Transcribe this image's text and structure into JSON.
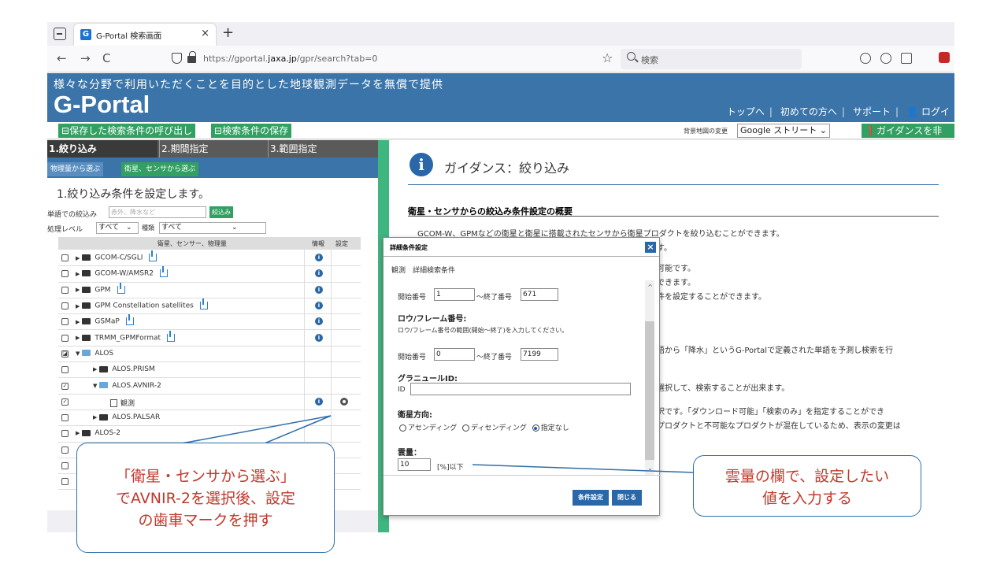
{
  "browser": {
    "tab_title": "G-Portal 検索画面",
    "tab_close": "×",
    "new_tab": "+",
    "back": "←",
    "forward": "→",
    "reload": "C",
    "url_host_prefix": "https://gportal.",
    "url_host_bold": "jaxa.jp",
    "url_path": "/gpr/search?tab=0",
    "search_placeholder": "検索"
  },
  "site": {
    "tagline": "様々な分野で利用いただくことを目的とした地球観測データを無償で提供",
    "logo": "G-Portal",
    "nav": [
      "トップへ",
      "初めての方へ",
      "サポート",
      "ログイ"
    ],
    "saved_conditions_btn": "保存した検索条件の呼び出し",
    "save_conditions_btn": "検索条件の保存",
    "bg_map_label": "背景地図の変更",
    "bg_map_value": "Google ストリート ⌄",
    "guidance_btn": "ガイダンスを非表"
  },
  "left": {
    "steps": [
      "1.絞り込み",
      "2.期間指定",
      "3.範囲指定"
    ],
    "modes": [
      "物理量から選ぶ",
      "衛星、センサから選ぶ"
    ],
    "filter_title": "1.絞り込み条件を設定します。",
    "keyword_label": "単語での絞込み",
    "keyword_placeholder": "赤外、降水など",
    "keyword_btn": "絞込み",
    "level_label": "処理レベル",
    "level_value": "すべて　⌄",
    "mode_label": "種類",
    "mode_value": "すべて　　　　　　　⌄",
    "tree_headers": [
      "衛星、センサー、物理量",
      "情報",
      "設定"
    ],
    "tree": [
      {
        "label": "GCOM-C/SGLI",
        "indent": 0,
        "dl": true,
        "info": true
      },
      {
        "label": "GCOM-W/AMSR2",
        "indent": 0,
        "dl": true,
        "info": true
      },
      {
        "label": "GPM",
        "indent": 0,
        "dl": true,
        "info": true
      },
      {
        "label": "GPM Constellation satellites",
        "indent": 0,
        "dl": true,
        "info": true
      },
      {
        "label": "GSMaP",
        "indent": 0,
        "dl": true,
        "info": true
      },
      {
        "label": "TRMM_GPMFormat",
        "indent": 0,
        "dl": true,
        "info": true
      },
      {
        "label": "ALOS",
        "indent": 0,
        "open": true,
        "check": "◪"
      },
      {
        "label": "ALOS.PRISM",
        "indent": 1
      },
      {
        "label": "ALOS.AVNIR-2",
        "indent": 1,
        "open": true,
        "check": "✓"
      },
      {
        "label": "観測",
        "indent": 2,
        "obs": true,
        "info": true,
        "gear": true,
        "check": "✓"
      },
      {
        "label": "ALOS.PALSAR",
        "indent": 1
      },
      {
        "label": "ALOS-2",
        "indent": 0
      },
      {
        "label": "",
        "indent": 0
      },
      {
        "label": "",
        "indent": 0
      },
      {
        "label": "",
        "indent": 0
      }
    ]
  },
  "guidance": {
    "icon": "i",
    "title": "ガイダンス：絞り込み",
    "subtitle": "衛星・センサからの絞込み条件設定の概要",
    "lines": [
      "GCOM-W、GPMなどの衛星と衛星に搭載されたセンサから衛星プロダクトを絞り込むことができます。",
      "す。",
      "可能です。",
      "できます。",
      "件を設定することができます。",
      "語から「降水」というG-Portalで定義された単語を予測し検索を行",
      "選択して、検索することが出来ます。",
      "択です。「ダウンロード可能」「検索のみ」を指定することができ",
      "プロダクトと不可能なプロダクトが混在しているため、表示の変更は"
    ]
  },
  "modal": {
    "title": "詳細条件設定",
    "close": "×",
    "crumb": "観測　詳細検索条件",
    "start_label": "開始番号",
    "end_label": "～終了番号",
    "path_start": "1",
    "path_end": "671",
    "row_head": "ロウ/フレーム番号:",
    "row_note": "ロウ/フレーム番号の範囲(開始～終了)を入力してください。",
    "row_start": "0",
    "row_end": "7199",
    "granule_head": "グラニュールID:",
    "granule_label": "ID",
    "granule_value": "",
    "direction_head": "衛星方向:",
    "direction_options": [
      "アセンディング",
      "ディセンディング",
      "指定なし"
    ],
    "cloud_head": "雲量：",
    "cloud_value": "10",
    "cloud_unit": "[%]以下",
    "apply_btn": "条件設定",
    "close_btn": "閉じる"
  },
  "callouts": {
    "left": [
      "「衛星・センサから選ぶ」",
      "でAVNIR-2を選択後、設定",
      "の歯車マークを押す"
    ],
    "right": [
      "雲量の欄で、設定したい",
      "値を入力する"
    ]
  }
}
